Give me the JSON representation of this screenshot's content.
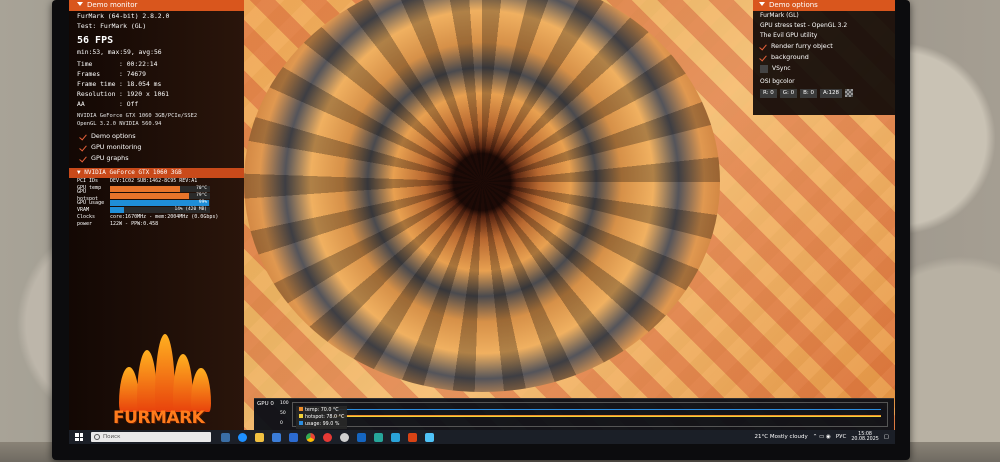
{
  "osd_left": {
    "header": "Demo monitor",
    "app_title": "FurMark (64-bit) 2.8.2.0",
    "test": "Test: FurMark (GL)",
    "fps": "56 FPS",
    "minmax": "min:53, max:59, avg:56",
    "stats": [
      {
        "label": "Time",
        "value": "00:22:14"
      },
      {
        "label": "Frames",
        "value": "74679"
      },
      {
        "label": "Frame time",
        "value": "18.054 ms"
      },
      {
        "label": "Resolution",
        "value": "1920 x 1061"
      },
      {
        "label": "AA",
        "value": "Off"
      }
    ],
    "gpu_info_1": "NVIDIA GeForce GTX 1060 3GB/PCIe/SSE2",
    "gpu_info_2": "OpenGL 3.2.0 NVIDIA 560.94",
    "checks": [
      "Demo options",
      "GPU monitoring",
      "GPU graphs"
    ],
    "gpu_header": "NVIDIA GeForce GTX 1060 3GB",
    "gpu_rows": [
      {
        "label": "PCI IDs",
        "text": "DEV:1C02 SUB:1462-8C95 REV:A1"
      },
      {
        "label": "GPU temp",
        "bar": 0.7,
        "bar_color": "#e8742a",
        "bar_text": "70°C"
      },
      {
        "label": "GPU hotspot",
        "bar": 0.79,
        "bar_color": "#e8742a",
        "bar_text": "79°C"
      },
      {
        "label": "GPU usage",
        "bar": 0.99,
        "bar_color": "#1f8ed8",
        "bar_text": "99%"
      },
      {
        "label": "VRAM",
        "bar": 0.14,
        "bar_color": "#1f8ed8",
        "bar_text": "14% (420 MB)"
      },
      {
        "label": "Clocks",
        "text": "core:1670MHz - mem:2004MHz (0.0Gbps)"
      },
      {
        "label": "power",
        "text": "122W - PPW:0.458"
      }
    ]
  },
  "osd_right": {
    "header": "Demo options",
    "lines": [
      "FurMark (GL)",
      "GPU stress test - OpenGL 3.2",
      "The Evil GPU utility"
    ],
    "checks": [
      "Render furry object",
      "background"
    ],
    "vsync": "VSync",
    "bgcolor_label": "OSI bgcolor",
    "bgcolor": [
      "R: 0",
      "G: 0",
      "B: 0",
      "A:128"
    ]
  },
  "logo": {
    "text": "FURMARK"
  },
  "graph": {
    "label": "GPU 0",
    "y_max": "100",
    "y_mid": "50",
    "y_min": "0",
    "legend": [
      {
        "label": "temp: 70.0 °C",
        "color": "#f08e2c"
      },
      {
        "label": "hotspot: 78.0 °C",
        "color": "#f2d23a"
      },
      {
        "label": "usage: 99.0 %",
        "color": "#2b8de0"
      }
    ]
  },
  "taskbar": {
    "search_placeholder": "Поиск",
    "weather": "21°C  Mostly cloudy",
    "lang": "РУС",
    "time": "15:08",
    "date": "20.08.2025"
  }
}
